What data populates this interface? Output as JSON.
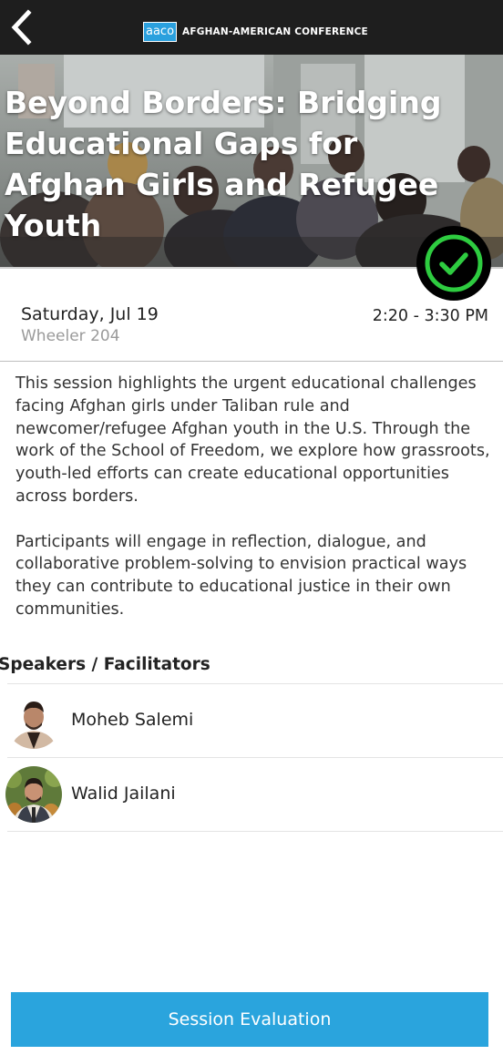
{
  "header": {
    "logo_text": "aaco",
    "brand_name": "AFGHAN-AMERICAN CONFERENCE"
  },
  "session": {
    "title": "Beyond Borders: Bridging Educational Gaps for Afghan Girls and Refugee Youth",
    "date": "Saturday, Jul 19",
    "room": "Wheeler 204",
    "time": "2:20 - 3:30 PM",
    "description": [
      "This session highlights the urgent educational challenges facing Afghan girls under Taliban rule and newcomer/refugee Afghan youth in the U.S. Through the work of the School of Freedom, we explore how grassroots, youth-led efforts can create educational opportunities across borders.",
      "Participants will engage in reflection, dialogue, and collaborative problem-solving to envision practical ways they can contribute to educational justice in their own communities."
    ]
  },
  "speakers": {
    "heading": "Speakers / Facilitators",
    "items": [
      {
        "name": "Moheb Salemi"
      },
      {
        "name": "Walid Jailani"
      }
    ]
  },
  "footer": {
    "evaluation_label": "Session Evaluation"
  },
  "colors": {
    "header_bg": "#1e1e1e",
    "accent": "#2aa4dd",
    "check_green": "#2ecc40"
  },
  "icons": {
    "back": "chevron-left-icon",
    "attending": "check-circle-icon"
  }
}
